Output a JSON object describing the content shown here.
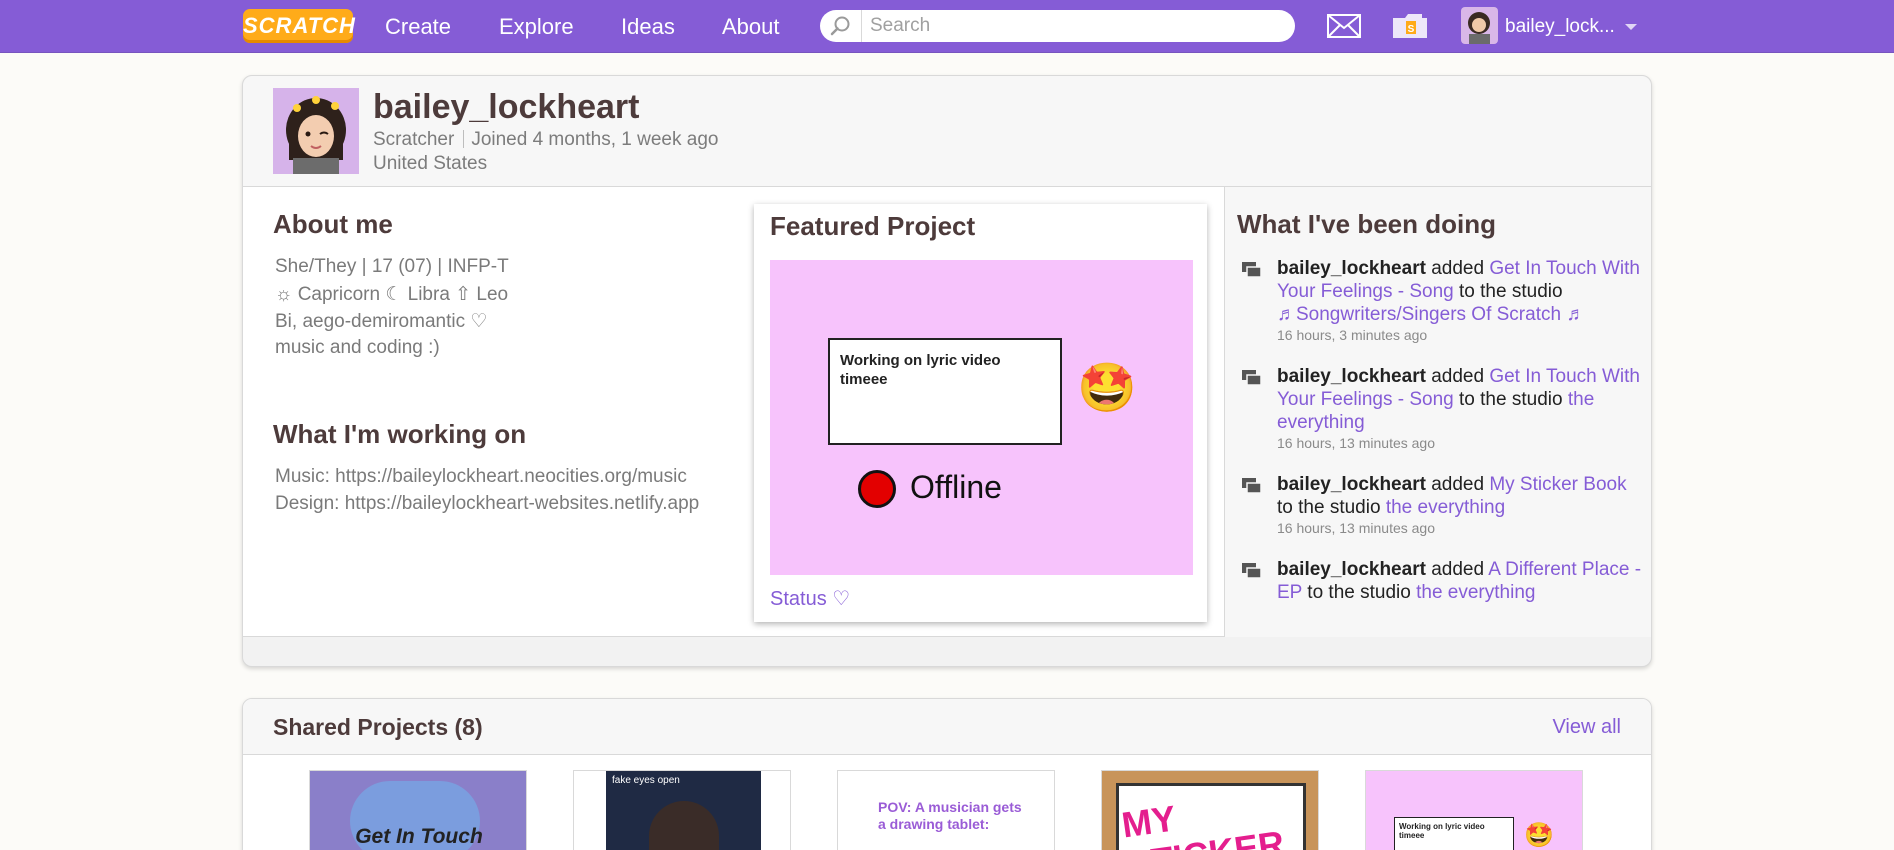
{
  "nav": {
    "logo": "SCRATCH",
    "links": [
      "Create",
      "Explore",
      "Ideas",
      "About"
    ],
    "search_placeholder": "Search",
    "username": "bailey_lock..."
  },
  "profile": {
    "username": "bailey_lockheart",
    "role": "Scratcher",
    "joined": "Joined 4 months, 1 week ago",
    "country": "United States",
    "about_title": "About me",
    "about_lines": [
      "She/They | 17 (07) | INFP-T",
      "☼ Capricorn ☾ Libra ⇧ Leo",
      "Bi, aego-demiromantic ♡",
      "music and coding :)"
    ],
    "working_title": "What I'm working on",
    "working_lines": [
      "Music: https://baileylockheart.neocities.org/music",
      "Design: https://baileylockheart-websites.netlify.app"
    ]
  },
  "featured": {
    "title": "Featured Project",
    "lyric_text": "Working on lyric video timeee",
    "offline_text": "Offline",
    "project_name": "Status ♡"
  },
  "activity": {
    "title": "What I've been doing",
    "items": [
      {
        "user": "bailey_lockheart",
        "verb": "added",
        "project": "Get In Touch With Your Feelings - Song",
        "mid": "to the studio",
        "studio": "♬Songwriters/Singers Of Scratch ♬",
        "time": "16 hours, 3 minutes ago"
      },
      {
        "user": "bailey_lockheart",
        "verb": "added",
        "project": "Get In Touch With Your Feelings - Song",
        "mid": "to the studio",
        "studio": "the everything",
        "time": "16 hours, 13 minutes ago"
      },
      {
        "user": "bailey_lockheart",
        "verb": "added",
        "project": "My Sticker Book",
        "mid": "to the studio",
        "studio": "the everything",
        "time": "16 hours, 13 minutes ago"
      },
      {
        "user": "bailey_lockheart",
        "verb": "added",
        "project": "A Different Place - EP",
        "mid": "to the studio",
        "studio": "the everything",
        "time": ""
      }
    ]
  },
  "shared": {
    "title": "Shared Projects (8)",
    "view_all": "View all",
    "thumbs": [
      {
        "caption": "Get In Touch",
        "bg": "#8a7fc9"
      },
      {
        "caption": "fake eyes open",
        "bg": "#1f2a44"
      },
      {
        "caption": "POV: A musician gets a drawing tablet:",
        "bg": "#ffffff"
      },
      {
        "caption": "MY STICKER",
        "bg": "#c8945a"
      },
      {
        "caption": "Working on lyric video timeee",
        "bg": "#f7c3fc"
      }
    ]
  },
  "colors": {
    "nav_bg": "#855cd6",
    "link": "#855cd6",
    "heading": "#4d3b3b",
    "feat_bg": "#f7c3fc",
    "offline_red": "#e30000"
  }
}
